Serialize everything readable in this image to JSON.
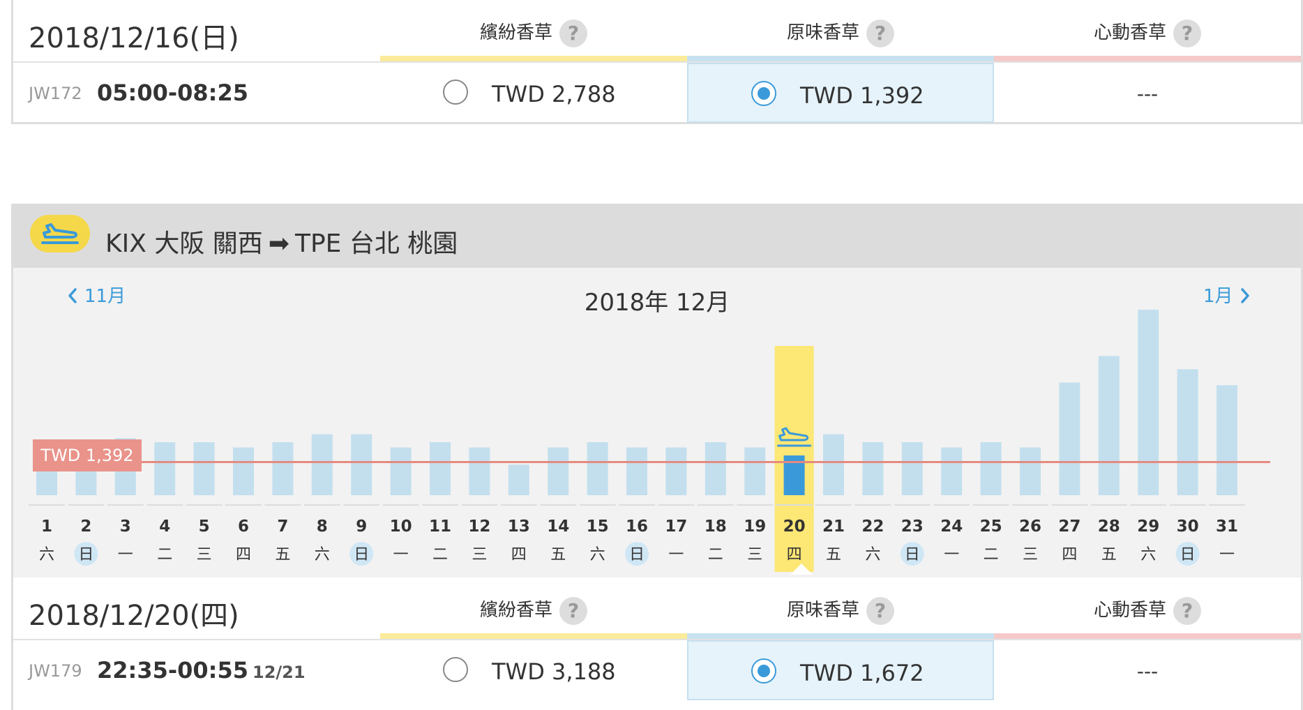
{
  "colors": {
    "class1": "#fbeb9a",
    "class2": "#c7e1f0",
    "class3": "#f6c9c9",
    "bar": "#c3dfee",
    "bar_selected": "#3a9ad9",
    "highlight": "#fde775",
    "threshold": "#e58a80",
    "threshold_label_bg": "#e9938a",
    "sunday_circle": "#cfe6f5"
  },
  "top_fare": {
    "date": "2018/12/16(日)",
    "classes": [
      {
        "label": "繽紛香草",
        "help": "?"
      },
      {
        "label": "原味香草",
        "help": "?"
      },
      {
        "label": "心動香草",
        "help": "?"
      }
    ],
    "flight": {
      "no": "JW172",
      "time": "05:00-08:25",
      "next_day": ""
    },
    "fares": [
      {
        "price": "TWD 2,788",
        "selected": false
      },
      {
        "price": "TWD 1,392",
        "selected": true
      },
      {
        "price": "---",
        "selected": false
      }
    ]
  },
  "route": {
    "plane_icon": "plane-icon",
    "from": "KIX 大阪 關西",
    "arrow": "➡",
    "to": "TPE 台北 桃園"
  },
  "calendar": {
    "prev": "11月",
    "title": "2018年 12月",
    "next": "1月",
    "prev_icon": "chevron-left-icon",
    "next_icon": "chevron-right-icon"
  },
  "chart_data": {
    "type": "bar",
    "threshold_label": "TWD 1,392",
    "threshold_ratio": 0.25,
    "selected_day": "20",
    "categories": [
      "1",
      "2",
      "3",
      "4",
      "5",
      "6",
      "7",
      "8",
      "9",
      "10",
      "11",
      "12",
      "13",
      "14",
      "15",
      "16",
      "17",
      "18",
      "19",
      "20",
      "21",
      "22",
      "23",
      "24",
      "25",
      "26",
      "27",
      "28",
      "29",
      "30",
      "31"
    ],
    "weekdays": [
      "六",
      "日",
      "一",
      "二",
      "三",
      "四",
      "五",
      "六",
      "日",
      "一",
      "二",
      "三",
      "四",
      "五",
      "六",
      "日",
      "一",
      "二",
      "三",
      "四",
      "五",
      "六",
      "日",
      "一",
      "二",
      "三",
      "四",
      "五",
      "六",
      "日",
      "一"
    ],
    "values": [
      0.4,
      0.4,
      0.43,
      0.4,
      0.4,
      0.36,
      0.4,
      0.46,
      0.46,
      0.36,
      0.4,
      0.36,
      0.23,
      0.36,
      0.4,
      0.36,
      0.36,
      0.4,
      0.36,
      0.3,
      0.46,
      0.4,
      0.4,
      0.36,
      0.4,
      0.36,
      0.85,
      1.05,
      1.4,
      0.95,
      0.83
    ]
  },
  "bottom_fare": {
    "date": "2018/12/20(四)",
    "classes": [
      {
        "label": "繽紛香草",
        "help": "?"
      },
      {
        "label": "原味香草",
        "help": "?"
      },
      {
        "label": "心動香草",
        "help": "?"
      }
    ],
    "flight": {
      "no": "JW179",
      "time": "22:35-00:55",
      "next_day": "12/21"
    },
    "fares": [
      {
        "price": "TWD 3,188",
        "selected": false
      },
      {
        "price": "TWD 1,672",
        "selected": true
      },
      {
        "price": "---",
        "selected": false
      }
    ]
  }
}
